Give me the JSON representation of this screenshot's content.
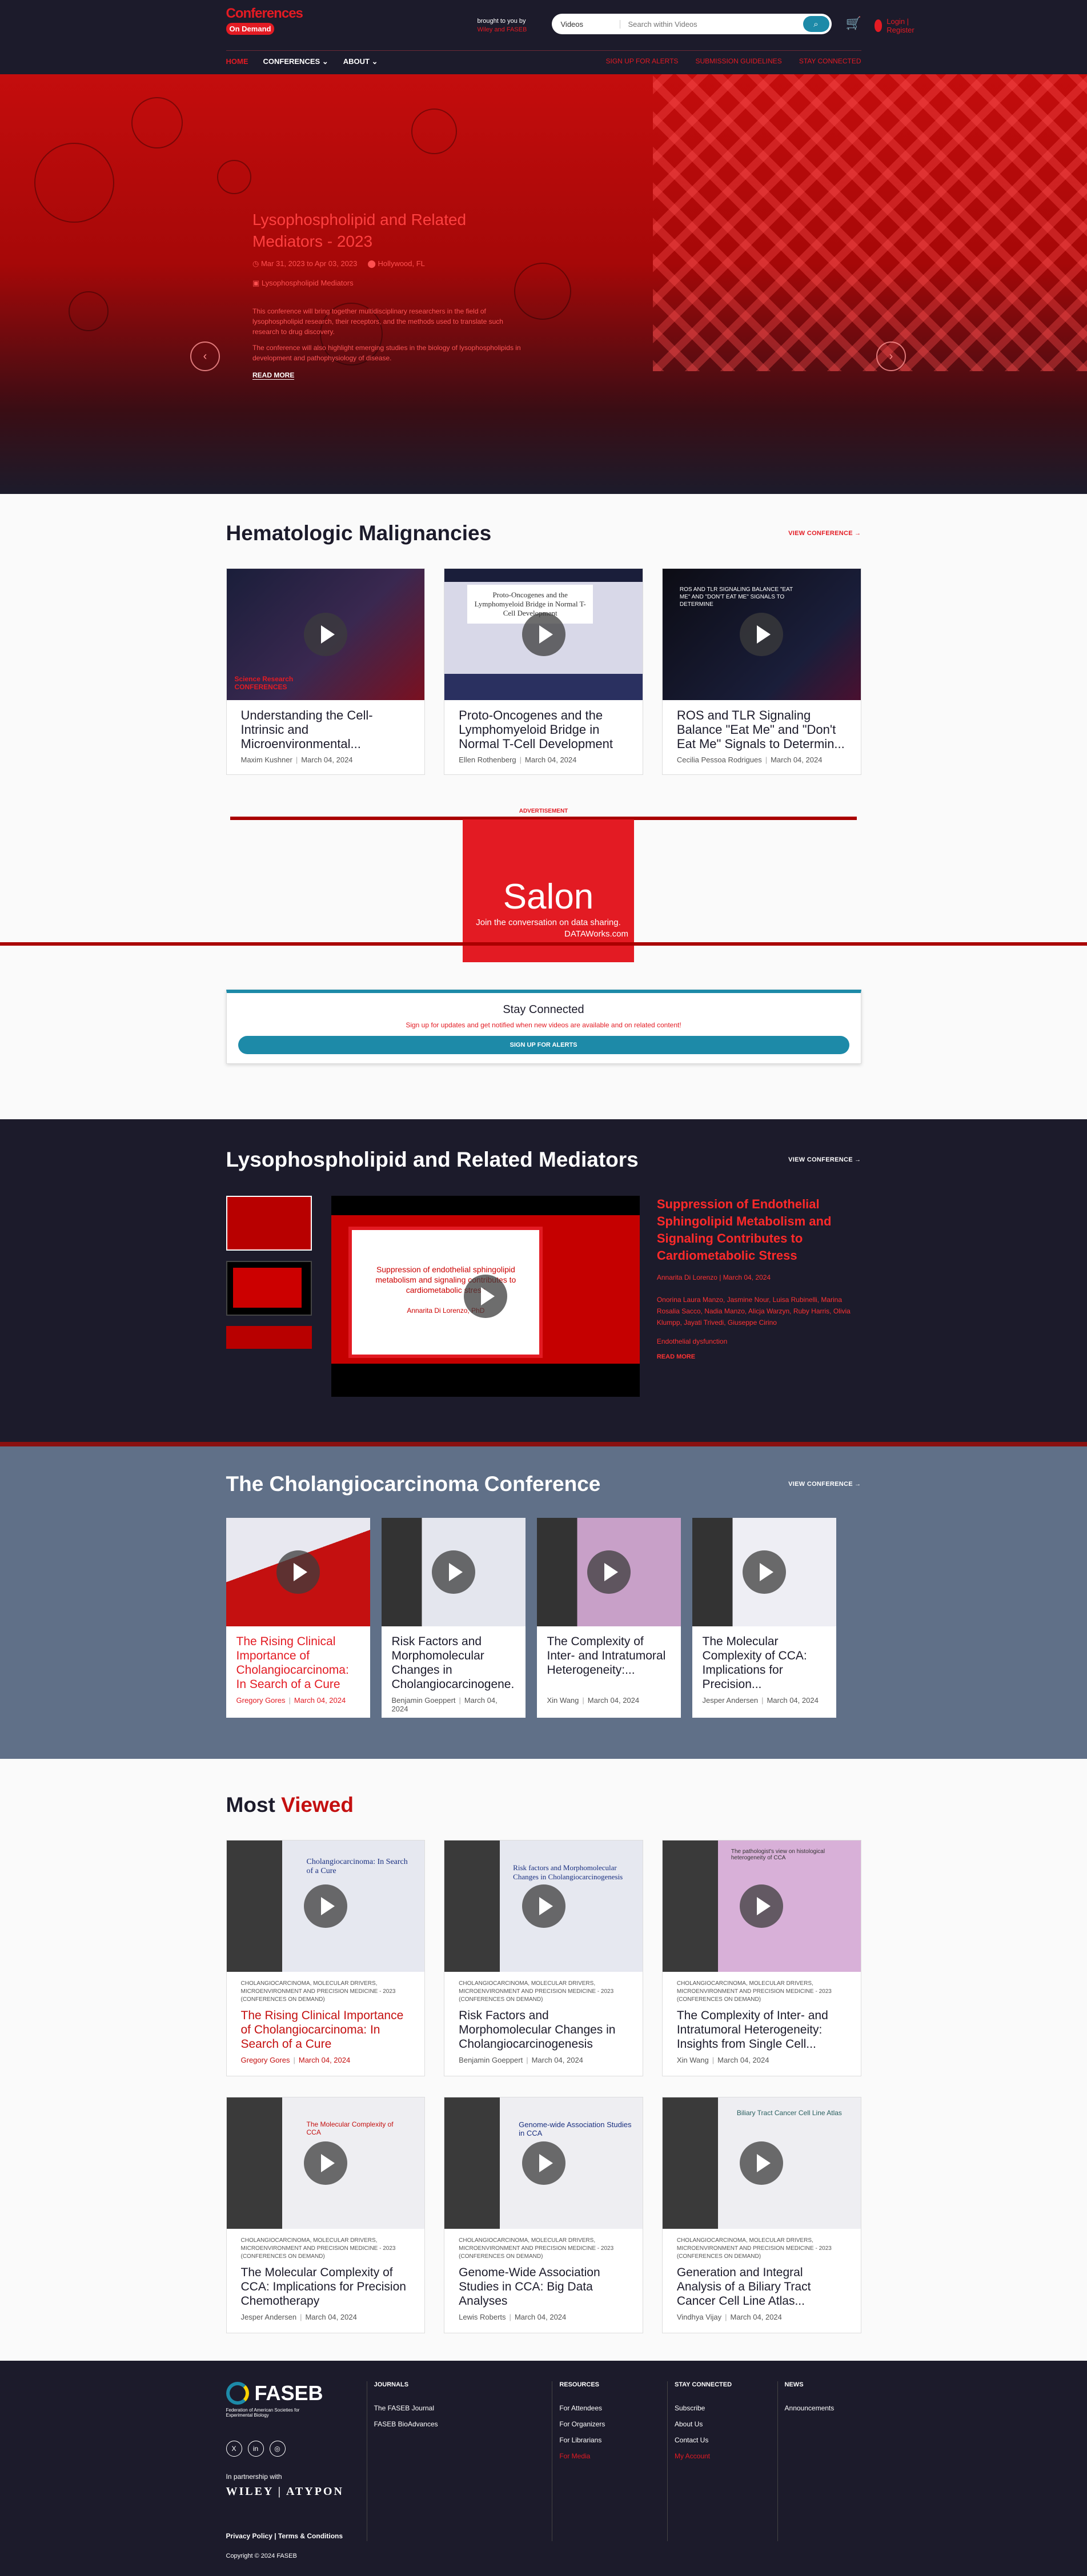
{
  "header": {
    "logo_line1": "Conferences",
    "logo_line2": "On Demand",
    "brought_line1": "brought to you by",
    "brought_line2": "Wiley and FASEB",
    "search_scope": "Videos",
    "search_placeholder": "Search within Videos",
    "login": "Login | Register",
    "nav": [
      "HOME",
      "CONFERENCES",
      "ABOUT"
    ],
    "nav_right": [
      "SIGN UP FOR ALERTS",
      "SUBMISSION GUIDELINES",
      "STAY CONNECTED"
    ]
  },
  "hero": {
    "title": "Lysophospholipid and Related Mediators - 2023",
    "date": "Mar 31, 2023 to Apr 03, 2023",
    "location": "Hollywood, FL",
    "extra": "Lysophospholipid Mediators",
    "desc1": "This conference will bring together multidisciplinary researchers in the field of lysophospholipid research, their receptors, and the methods used to translate such research to drug discovery.",
    "desc2": "The conference will also highlight emerging studies in the biology of lysophospholipids in development and pathophysiology of disease.",
    "read_more": "READ MORE",
    "prev": "‹",
    "next": "›"
  },
  "hema": {
    "title": "Hematologic Malignancies",
    "view": "VIEW CONFERENCE →",
    "cards": [
      {
        "title": "Understanding the Cell-Intrinsic and Microenvironmental...",
        "author": "Maxim Kushner",
        "date": "March 04, 2024"
      },
      {
        "title": "Proto-Oncogenes and the Lymphomyeloid Bridge in Normal T-Cell Development",
        "author": "Ellen Rothenberg",
        "date": "March 04, 2024"
      },
      {
        "title": "ROS and TLR Signaling Balance \"Eat Me\" and \"Don't Eat Me\" Signals to Determin...",
        "author": "Cecilia Pessoa Rodrigues",
        "date": "March 04, 2024"
      }
    ],
    "thumb1_text": "Science Research CONFERENCES",
    "thumb2_text": "Proto-Oncogenes and the Lymphomyeloid Bridge in Normal T-Cell Development",
    "thumb3_text": "ROS AND TLR SIGNALING BALANCE \"EAT ME\" AND \"DON'T EAT ME\" SIGNALS TO DETERMINE"
  },
  "ad": {
    "label": "ADVERTISEMENT",
    "big": "Salon",
    "sub": "Join the conversation on data sharing.",
    "brand": "DATAWorks.com"
  },
  "stay": {
    "title": "Stay Connected",
    "desc": "Sign up for updates and get notified when new videos are available and on related content!",
    "button": "SIGN UP FOR ALERTS"
  },
  "lyso": {
    "title": "Lysophospholipid and Related Mediators",
    "view": "VIEW CONFERENCE →",
    "video_title": "Suppression of Endothelial Sphingolipid Metabolism and Signaling Contributes to Cardiometabolic Stress",
    "date": "Annarita Di Lorenzo | March 04, 2024",
    "slide_title": "Suppression of endothelial sphingolipid metabolism and signaling contributes to cardiometabolic stress",
    "slide_author": "Annarita Di Lorenzo, PhD",
    "authors": "Onorina Laura Manzo, Jasmine Nour, Luisa Rubinelli, Marina Rosalia Sacco, Nadia Manzo, Alicja Warzyn, Ruby Harris, Olivia Klumpp, Jayati Trivedi, Giuseppe Cirino",
    "desc": "Endothelial dysfunction",
    "read_more": "READ MORE"
  },
  "chol": {
    "title": "The Cholangiocarcinoma Conference",
    "view": "VIEW CONFERENCE →",
    "cards": [
      {
        "title": "The Rising Clinical Importance of Cholangiocarcinoma: In Search of a Cure",
        "author": "Gregory Gores",
        "date": "March 04, 2024"
      },
      {
        "title": "Risk Factors and Morphomolecular Changes in Cholangiocarcinogene...",
        "author": "Benjamin Goeppert",
        "date": "March 04, 2024"
      },
      {
        "title": "The Complexity of Inter- and Intratumoral Heterogeneity:...",
        "author": "Xin Wang",
        "date": "March 04, 2024"
      },
      {
        "title": "The Molecular Complexity of CCA: Implications for Precision...",
        "author": "Jesper Andersen",
        "date": "March 04, 2024"
      }
    ]
  },
  "most": {
    "title_a": "Most ",
    "title_b": "Viewed",
    "cats": "CHOLANGIOCARCINOMA, MOLECULAR DRIVERS, MICROENVIRONMENT AND PRECISION MEDICINE - 2023 (CONFERENCES ON DEMAND)",
    "cards": [
      {
        "title": "The Rising Clinical Importance of Cholangiocarcinoma: In Search of a Cure",
        "author": "Gregory Gores",
        "date": "March 04, 2024",
        "thumb": "Cholangiocarcinoma: In Search of a Cure"
      },
      {
        "title": "Risk Factors and Morphomolecular Changes in Cholangiocarcinogenesis",
        "author": "Benjamin Goeppert",
        "date": "March 04, 2024",
        "thumb": "Risk factors and Morphomolecular Changes in Cholangiocarcinogenesis"
      },
      {
        "title": "The Complexity of Inter- and Intratumoral Heterogeneity: Insights from Single Cell...",
        "author": "Xin Wang",
        "date": "March 04, 2024",
        "thumb": "The pathologist's view on histological heterogeneity of CCA"
      },
      {
        "title": "The Molecular Complexity of CCA: Implications for Precision Chemotherapy",
        "author": "Jesper Andersen",
        "date": "March 04, 2024",
        "thumb": "The Molecular Complexity of CCA"
      },
      {
        "title": "Genome-Wide Association Studies in CCA: Big Data Analyses",
        "author": "Lewis Roberts",
        "date": "March 04, 2024",
        "thumb": "Genome-wide Association Studies in CCA"
      },
      {
        "title": "Generation and Integral Analysis of a Biliary Tract Cancer Cell Line Atlas...",
        "author": "Vindhya Vijay",
        "date": "March 04, 2024",
        "thumb": "Biliary Tract Cancer Cell Line Atlas"
      }
    ]
  },
  "footer": {
    "brand": "FASEB",
    "tag": "Federation of American Societies for Experimental Biology",
    "partner": "In partnership with",
    "wiley": "WILEY | ATYPON",
    "cols": [
      {
        "head": "JOURNALS",
        "links": [
          "The FASEB Journal",
          "FASEB BioAdvances"
        ]
      },
      {
        "head": "RESOURCES",
        "links": [
          "For Attendees",
          "For Organizers",
          "For Librarians",
          "For Media"
        ]
      },
      {
        "head": "STAY CONNECTED",
        "links": [
          "Subscribe",
          "About Us",
          "Contact Us",
          "My Account"
        ]
      },
      {
        "head": "NEWS",
        "links": [
          "Announcements"
        ]
      }
    ],
    "bottom_links": "Privacy Policy  |  Terms & Conditions",
    "copyright": "Copyright © 2024 FASEB"
  },
  "colors": {
    "brand_red": "#e31b23",
    "dark_navy": "#1c1b2b",
    "teal": "#1d8aa8",
    "slate": "#607088"
  }
}
